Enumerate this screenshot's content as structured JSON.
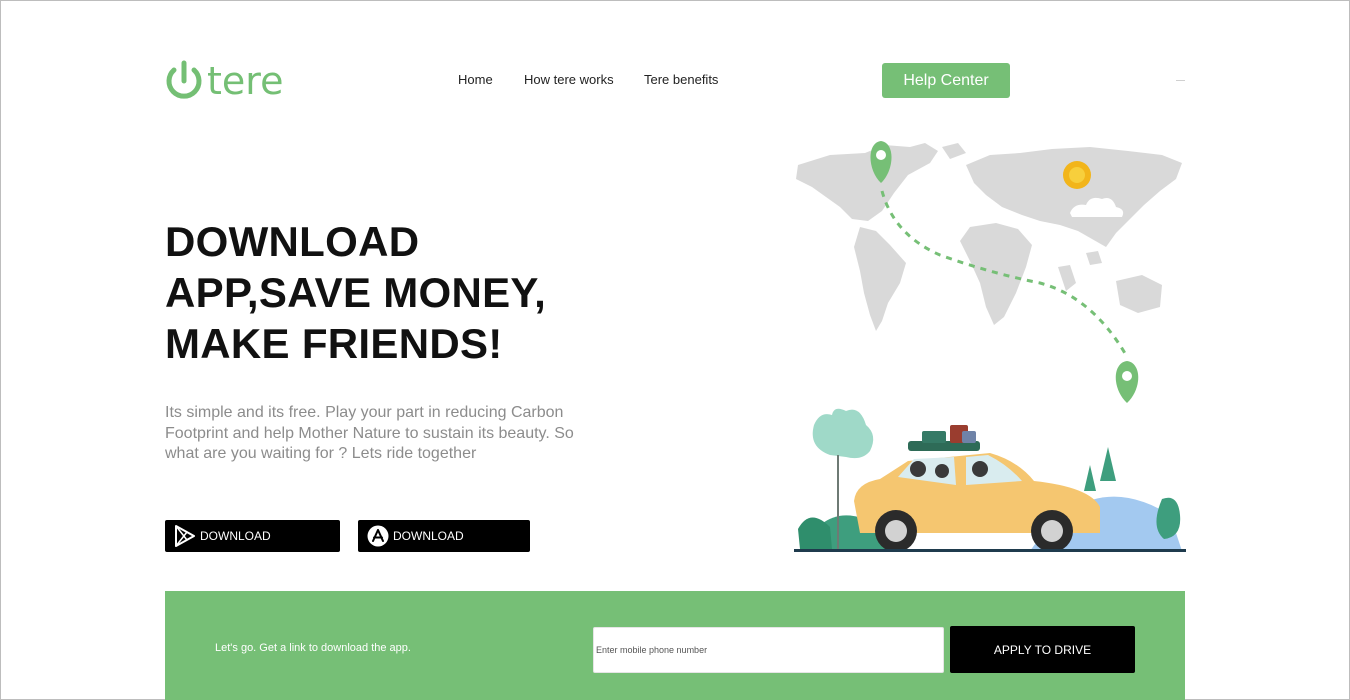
{
  "header": {
    "logo_text": "tere",
    "nav": [
      "Home",
      "How tere works",
      "Tere benefits"
    ],
    "help_label": "Help Center"
  },
  "hero": {
    "headline": [
      "DOWNLOAD",
      "APP,SAVE MONEY,",
      "MAKE FRIENDS!"
    ],
    "description": "Its simple and its free. Play your part in reducing Carbon Footprint and help Mother Nature to sustain its beauty. So what are you waiting for ? Lets ride together",
    "downloads": [
      {
        "label": "DOWNLOAD",
        "icon": "play-store-icon"
      },
      {
        "label": "DOWNLOAD",
        "icon": "app-store-icon"
      }
    ]
  },
  "cta": {
    "text": "Let's go. Get a link to download the app.",
    "phone_placeholder": "Enter mobile phone number",
    "apply_label": "APPLY TO DRIVE"
  },
  "colors": {
    "brand_green": "#76bf76",
    "map_gray": "#d9d9d9",
    "car_yellow": "#f5c670",
    "text_dark": "#111111",
    "text_muted": "#8c8c8c"
  }
}
